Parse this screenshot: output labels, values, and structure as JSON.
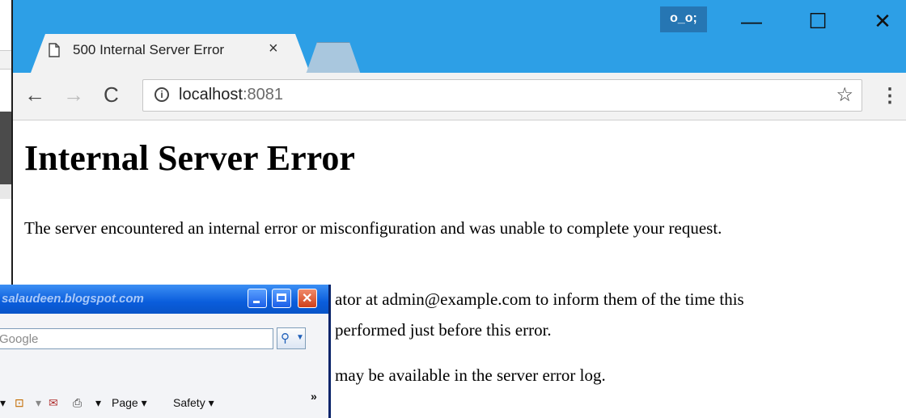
{
  "browser": {
    "tab": {
      "title": "500 Internal Server Error",
      "close_glyph": "×"
    },
    "profile_badge": "o_o;",
    "window_controls": {
      "minimize": "—",
      "maximize": "☐",
      "close": "✕"
    },
    "toolbar": {
      "back_glyph": "←",
      "forward_glyph": "→",
      "reload_glyph": "C",
      "url_host": "localhost",
      "url_port": ":8081",
      "info_glyph": "i",
      "star_glyph": "☆",
      "menu_glyph": "⋮"
    }
  },
  "page": {
    "heading": "Internal Server Error",
    "paragraph1": "The server encountered an internal error or misconfiguration and was unable to complete your request.",
    "paragraph2_line1": "ator at admin@example.com to inform them of the time this",
    "paragraph2_line2": "performed just before this error.",
    "paragraph3": "may be available in the server error log."
  },
  "ie_window": {
    "title": "salaudeen.blogspot.com",
    "search_placeholder": "Google",
    "search_glyph": "⚲",
    "command_bar": {
      "page_label": "Page ▾",
      "safety_label": "Safety ▾",
      "rss_glyph": "⊡",
      "mail_glyph": "✉",
      "print_glyph": "⎙",
      "overflow_glyph": "»"
    }
  }
}
